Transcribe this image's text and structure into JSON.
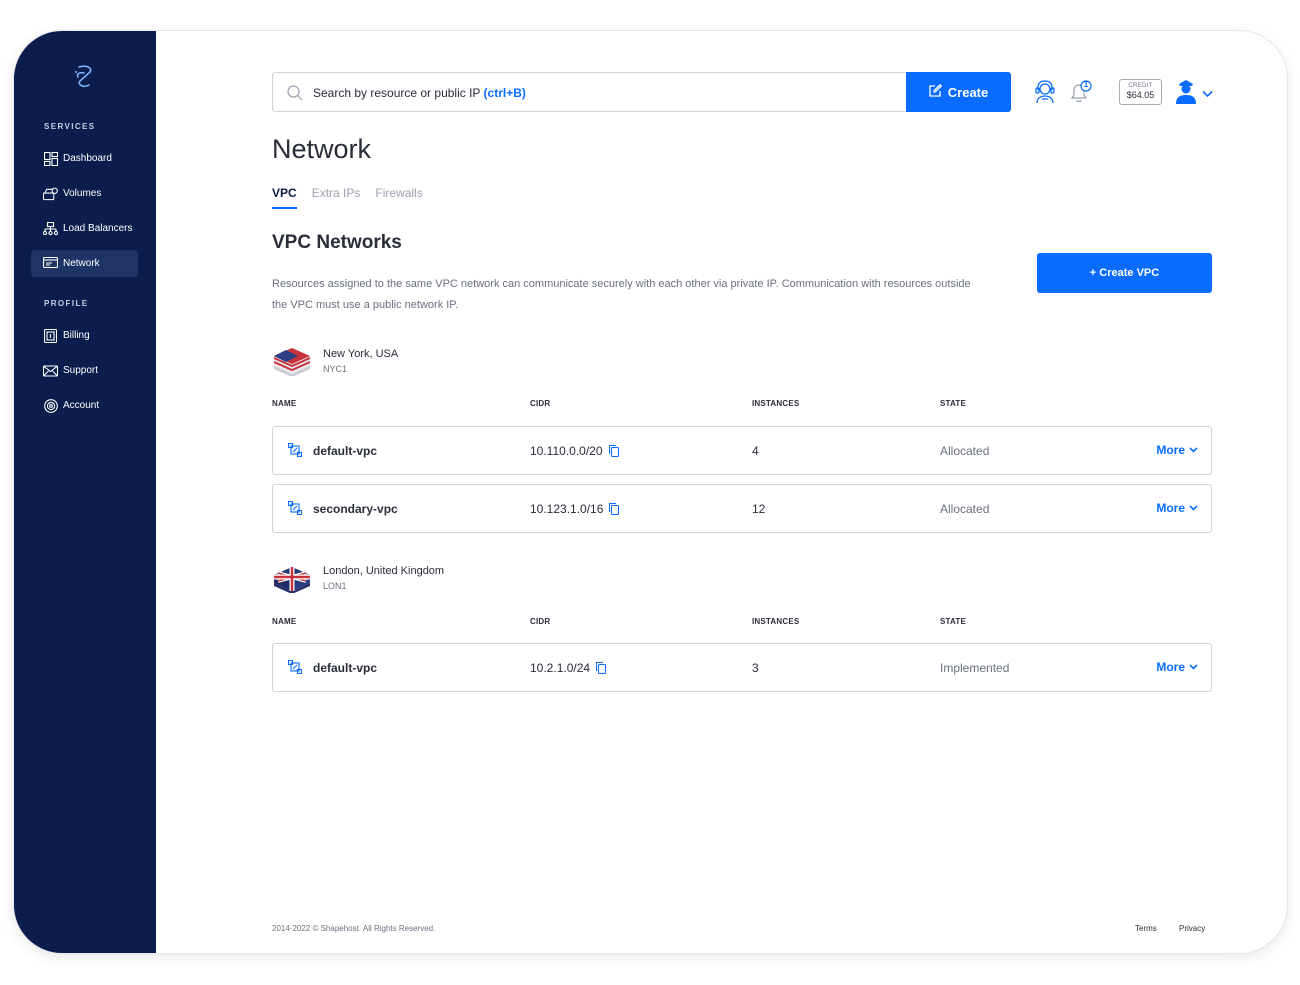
{
  "sidebar": {
    "services_heading": "SERVICES",
    "profile_heading": "PROFILE",
    "items": [
      {
        "label": "Dashboard",
        "icon": "dashboard-icon"
      },
      {
        "label": "Volumes",
        "icon": "volumes-icon"
      },
      {
        "label": "Load Balancers",
        "icon": "load-balancer-icon"
      },
      {
        "label": "Network",
        "icon": "network-icon",
        "active": true
      },
      {
        "label": "Billing",
        "icon": "billing-icon"
      },
      {
        "label": "Support",
        "icon": "support-icon"
      },
      {
        "label": "Account",
        "icon": "account-icon"
      }
    ]
  },
  "search": {
    "placeholder": "Search by resource or public IP",
    "shortcut": "(ctrl+B)"
  },
  "header": {
    "create_label": "Create",
    "notification_count": "1",
    "credit_label": "CREDIT",
    "credit_value": "$64.05"
  },
  "page": {
    "title": "Network",
    "tabs": [
      "VPC",
      "Extra IPs",
      "Firewalls"
    ],
    "active_tab": "VPC",
    "section_title": "VPC Networks",
    "section_description": "Resources assigned to the same VPC network can communicate securely with each other via private IP. Communication with resources outside the VPC must use a public network IP.",
    "create_vpc_label": "+ Create VPC"
  },
  "table_headers": [
    "NAME",
    "CIDR",
    "INSTANCES",
    "STATE"
  ],
  "regions": [
    {
      "name": "New York, USA",
      "code": "NYC1",
      "rows": [
        {
          "name": "default-vpc",
          "cidr": "10.110.0.0/20",
          "instances": "4",
          "state": "Allocated",
          "action": "More"
        },
        {
          "name": "secondary-vpc",
          "cidr": "10.123.1.0/16",
          "instances": "12",
          "state": "Allocated",
          "action": "More"
        }
      ]
    },
    {
      "name": "London, United Kingdom",
      "code": "LON1",
      "rows": [
        {
          "name": "default-vpc",
          "cidr": "10.2.1.0/24",
          "instances": "3",
          "state": "Implemented",
          "action": "More"
        }
      ]
    }
  ],
  "footer": {
    "copyright": "2014-2022 © Shapehost. All Rights Reserved.",
    "terms": "Terms",
    "privacy": "Privacy"
  },
  "colors": {
    "sidebar_bg": "#0b1d4c",
    "accent": "#0a6cff"
  }
}
